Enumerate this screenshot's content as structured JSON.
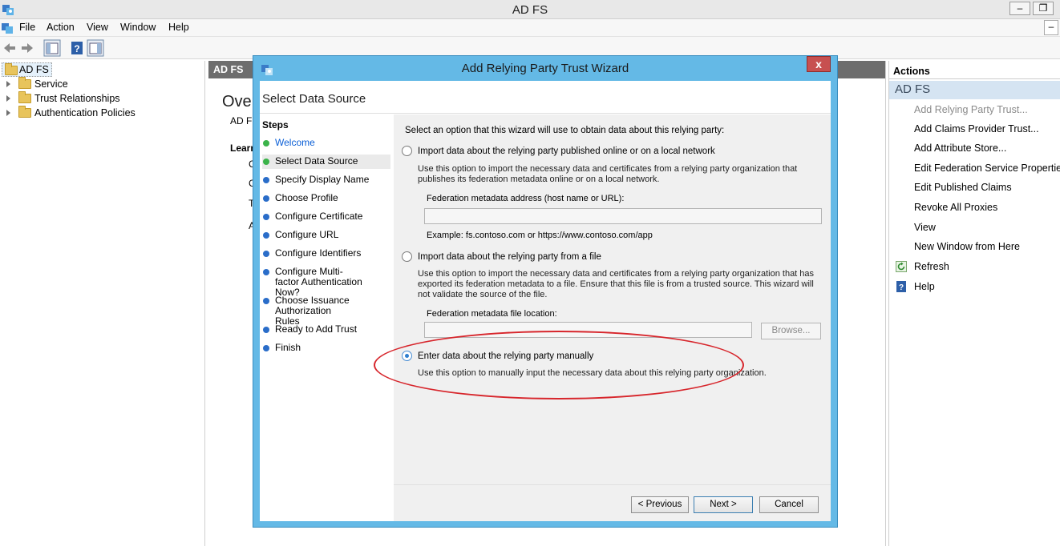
{
  "window": {
    "title": "AD FS"
  },
  "menu": [
    "File",
    "Action",
    "View",
    "Window",
    "Help"
  ],
  "tree": {
    "root": "AD FS",
    "nodes": [
      "Service",
      "Trust Relationships",
      "Authentication Policies"
    ]
  },
  "center": {
    "header": "AD FS",
    "overview_title_partial": "Over",
    "sub_partial": "AD FS",
    "learn_partial": "Learn",
    "clipped_chars": [
      "C",
      "C",
      "T",
      "A"
    ]
  },
  "actions": {
    "header": "Actions",
    "section": "AD FS",
    "items": [
      {
        "label": "Add Relying Party Trust...",
        "disabled": true,
        "icon": ""
      },
      {
        "label": "Add Claims Provider Trust...",
        "disabled": false,
        "icon": ""
      },
      {
        "label": "Add Attribute Store...",
        "disabled": false,
        "icon": ""
      },
      {
        "label": "Edit Federation Service Properties...",
        "disabled": false,
        "icon": ""
      },
      {
        "label": "Edit Published Claims",
        "disabled": false,
        "icon": ""
      },
      {
        "label": "Revoke All Proxies",
        "disabled": false,
        "icon": ""
      },
      {
        "label": "View",
        "disabled": false,
        "icon": ""
      },
      {
        "label": "New Window from Here",
        "disabled": false,
        "icon": ""
      },
      {
        "label": "Refresh",
        "disabled": false,
        "icon": "refresh-icon"
      },
      {
        "label": "Help",
        "disabled": false,
        "icon": "help-icon"
      }
    ]
  },
  "wizard": {
    "title": "Add Relying Party Trust Wizard",
    "close_glyph": "x",
    "heading": "Select Data Source",
    "steps_title": "Steps",
    "steps": [
      {
        "label": "Welcome",
        "status": "done"
      },
      {
        "label": "Select Data Source",
        "status": "current"
      },
      {
        "label": "Specify Display Name",
        "status": "pending"
      },
      {
        "label": "Choose Profile",
        "status": "pending"
      },
      {
        "label": "Configure Certificate",
        "status": "pending"
      },
      {
        "label": "Configure URL",
        "status": "pending"
      },
      {
        "label": "Configure Identifiers",
        "status": "pending"
      },
      {
        "label": "Configure Multi-factor Authentication Now?",
        "status": "pending"
      },
      {
        "label": "Choose Issuance Authorization Rules",
        "status": "pending"
      },
      {
        "label": "Ready to Add Trust",
        "status": "pending"
      },
      {
        "label": "Finish",
        "status": "pending"
      }
    ],
    "intro": "Select an option that this wizard will use to obtain data about this relying party:",
    "option1": {
      "label": "Import data about the relying party published online or on a local network",
      "desc": "Use this option to import the necessary data and certificates from a relying party organization that publishes its federation metadata online or on a local network.",
      "field_label": "Federation metadata address (host name or URL):",
      "field_value": "",
      "example": "Example: fs.contoso.com or https://www.contoso.com/app",
      "checked": false
    },
    "option2": {
      "label": "Import data about the relying party from a file",
      "desc": "Use this option to import the necessary data and certificates from a relying party organization that has exported its federation metadata to a file. Ensure that this file is from a trusted source.  This wizard will not validate the source of the file.",
      "field_label": "Federation metadata file location:",
      "field_value": "",
      "browse": "Browse...",
      "checked": false
    },
    "option3": {
      "label": "Enter data about the relying party manually",
      "desc": "Use this option to manually input the necessary data about this relying party organization.",
      "checked": true
    },
    "buttons": {
      "previous": "< Previous",
      "next": "Next >",
      "cancel": "Cancel"
    }
  },
  "colors": {
    "wizard_frame": "#64b9e6",
    "highlight": "#d7262c",
    "close": "#c75050"
  }
}
